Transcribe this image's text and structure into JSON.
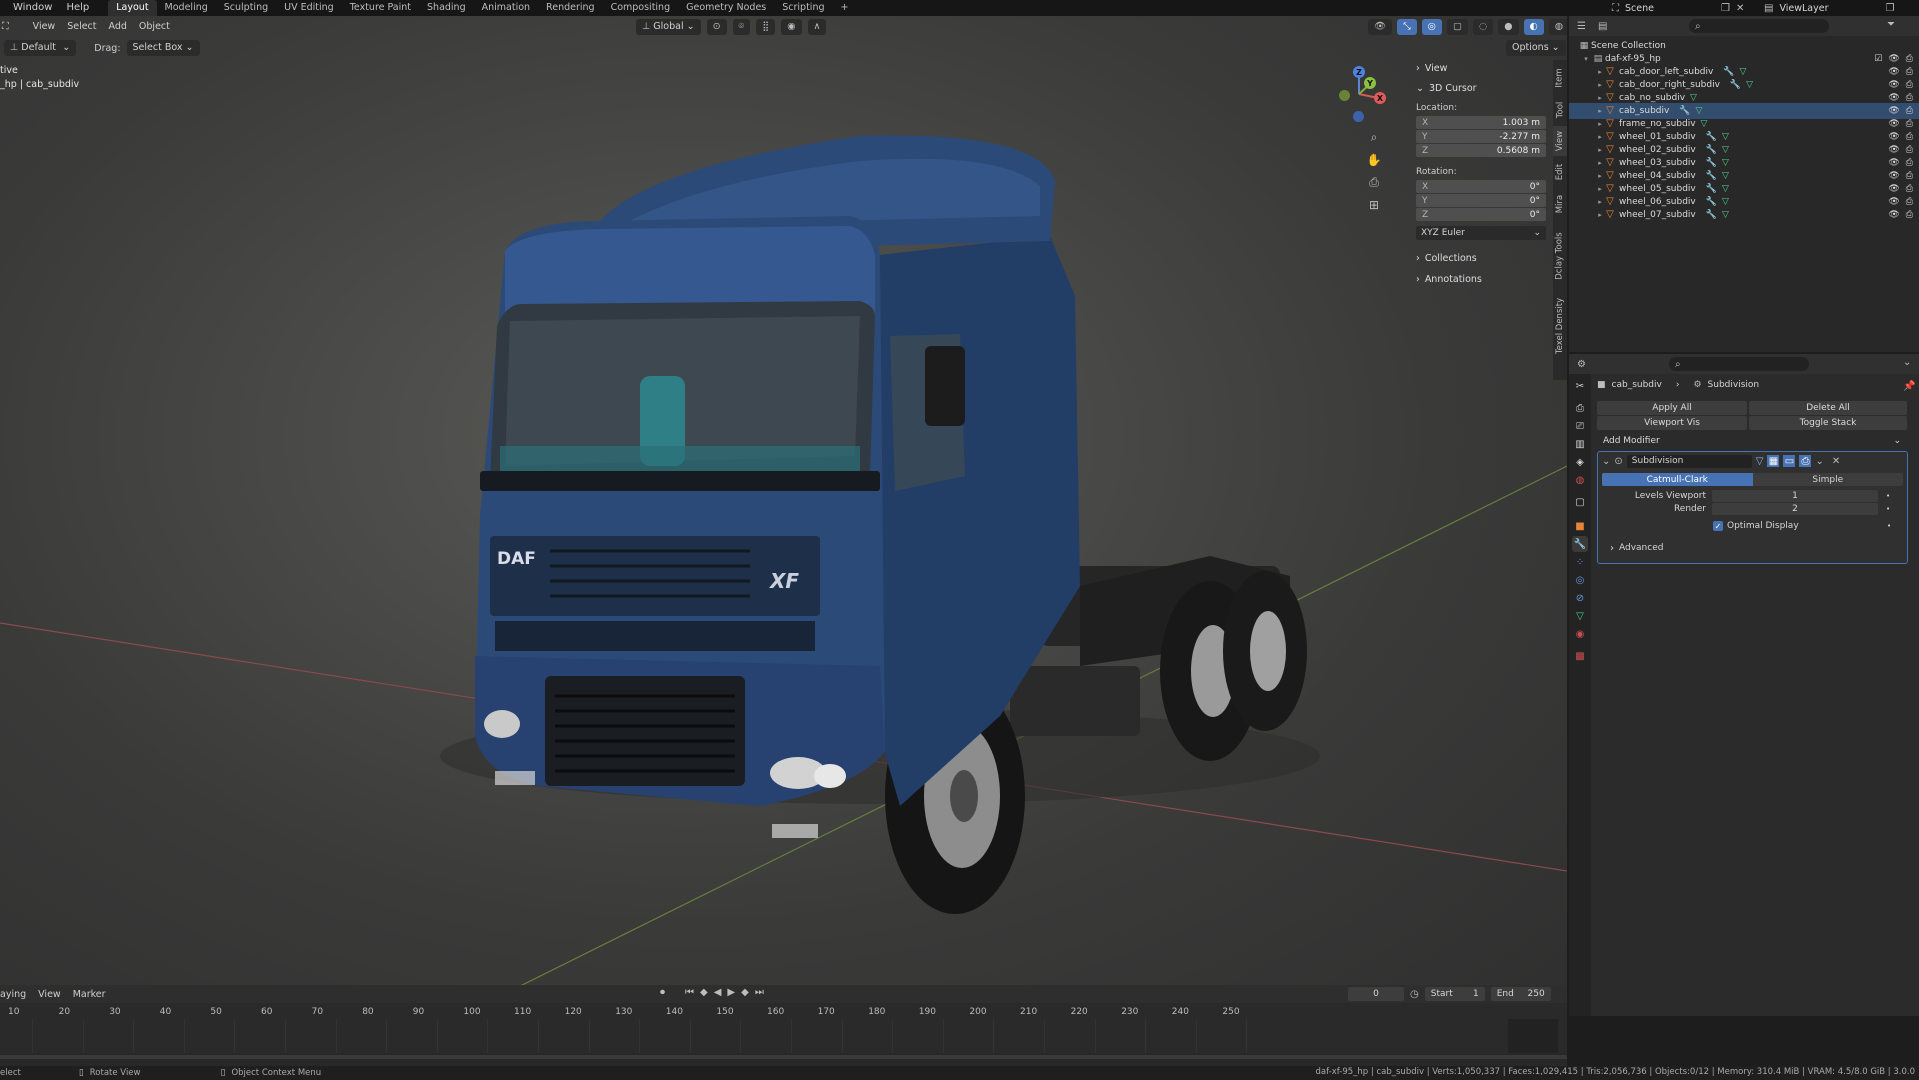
{
  "topbar": {
    "menus": [
      "Window",
      "Help"
    ],
    "workspaces": [
      "Layout",
      "Modeling",
      "Sculpting",
      "UV Editing",
      "Texture Paint",
      "Shading",
      "Animation",
      "Rendering",
      "Compositing",
      "Geometry Nodes",
      "Scripting"
    ],
    "active_workspace": "Layout",
    "add_tab": "+",
    "scene_label": "Scene",
    "viewlayer_label": "ViewLayer"
  },
  "viewport": {
    "header_menus": [
      "View",
      "Select",
      "Add",
      "Object"
    ],
    "transform_orientation": "Global",
    "orientation_label": "Default",
    "drag_label": "Drag:",
    "select_mode": "Select Box",
    "options_label": "Options",
    "info_mode": "tive",
    "info_object": "_hp | cab_subdiv"
  },
  "npanel": {
    "view_label": "View",
    "cursor_label": "3D Cursor",
    "location_label": "Location:",
    "location": [
      {
        "axis": "X",
        "value": "1.003 m"
      },
      {
        "axis": "Y",
        "value": "-2.277 m"
      },
      {
        "axis": "Z",
        "value": "0.5608 m"
      }
    ],
    "rotation_label": "Rotation:",
    "rotation": [
      {
        "axis": "X",
        "value": "0°"
      },
      {
        "axis": "Y",
        "value": "0°"
      },
      {
        "axis": "Z",
        "value": "0°"
      }
    ],
    "rotation_mode": "XYZ Euler",
    "collections_label": "Collections",
    "annotations_label": "Annotations",
    "tabs": [
      "Item",
      "Tool",
      "View",
      "Edit",
      "Mira",
      "Dclay Tools",
      "Texel Density"
    ]
  },
  "gizmo": {
    "z": "Z",
    "y": "Y",
    "x": "X"
  },
  "outliner": {
    "root": "Scene Collection",
    "collection": "daf-xf-95_hp",
    "objects": [
      {
        "name": "cab_door_left_subdiv",
        "modifier": true
      },
      {
        "name": "cab_door_right_subdiv",
        "modifier": true
      },
      {
        "name": "cab_no_subdiv",
        "modifier": false
      },
      {
        "name": "cab_subdiv",
        "modifier": true,
        "selected": true
      },
      {
        "name": "frame_no_subdiv",
        "modifier": false
      },
      {
        "name": "wheel_01_subdiv",
        "modifier": true
      },
      {
        "name": "wheel_02_subdiv",
        "modifier": true
      },
      {
        "name": "wheel_03_subdiv",
        "modifier": true
      },
      {
        "name": "wheel_04_subdiv",
        "modifier": true
      },
      {
        "name": "wheel_05_subdiv",
        "modifier": true
      },
      {
        "name": "wheel_06_subdiv",
        "modifier": true
      },
      {
        "name": "wheel_07_subdiv",
        "modifier": true
      }
    ]
  },
  "properties": {
    "breadcrumb_object": "cab_subdiv",
    "breadcrumb_modifier": "Subdivision",
    "apply_all": "Apply All",
    "delete_all": "Delete All",
    "viewport_vis": "Viewport Vis",
    "toggle_stack": "Toggle Stack",
    "add_modifier": "Add Modifier",
    "modifier_name": "Subdivision",
    "type_catmull": "Catmull-Clark",
    "type_simple": "Simple",
    "levels_viewport_label": "Levels Viewport",
    "levels_viewport_value": "1",
    "render_label": "Render",
    "render_value": "2",
    "optimal_display": "Optimal Display",
    "advanced": "Advanced"
  },
  "timeline": {
    "menus": [
      "aying",
      "View",
      "Marker"
    ],
    "current_frame": "0",
    "start_label": "Start",
    "start_value": "1",
    "end_label": "End",
    "end_value": "250",
    "ticks": [
      "10",
      "20",
      "30",
      "40",
      "50",
      "60",
      "70",
      "80",
      "90",
      "100",
      "110",
      "120",
      "130",
      "140",
      "150",
      "160",
      "170",
      "180",
      "190",
      "200",
      "210",
      "220",
      "230",
      "240",
      "250"
    ]
  },
  "status": {
    "left": "elect",
    "rotate": "Rotate View",
    "context": "Object Context Menu",
    "stats": "daf-xf-95_hp | cab_subdiv | Verts:1,050,337 | Faces:1,029,415 | Tris:2,056,736 | Objects:0/12 | Memory: 310.4 MiB | VRAM: 4.5/8.0 GiB | 3.0.0"
  },
  "colors": {
    "accent": "#4772b3",
    "truck_blue": "#2c4a78",
    "object_orange": "#e8843a",
    "mesh_green": "#4fd18c"
  }
}
